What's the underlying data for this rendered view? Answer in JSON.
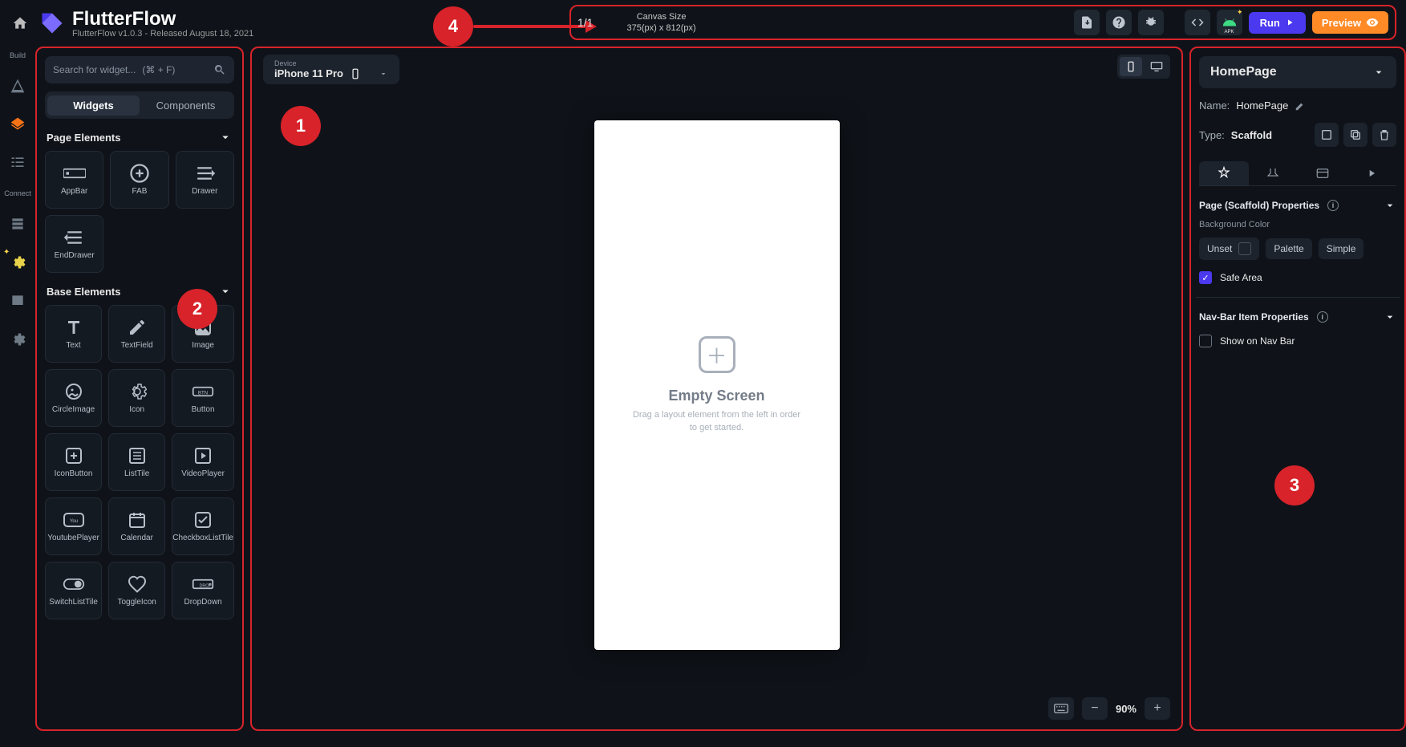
{
  "brand": {
    "title": "FlutterFlow",
    "subtitle": "FlutterFlow v1.0.3 - Released August 18, 2021"
  },
  "header": {
    "count": "1/1",
    "canvas_label": "Canvas Size",
    "canvas_value": "375(px) x 812(px)",
    "run": "Run",
    "preview": "Preview"
  },
  "activity": {
    "build": "Build",
    "connect": "Connect"
  },
  "left": {
    "search_placeholder": "Search for widget...",
    "search_hint": "(⌘ + F)",
    "tabs": {
      "widgets": "Widgets",
      "components": "Components"
    },
    "sections": {
      "page": "Page Elements",
      "base": "Base Elements"
    },
    "page_elements": [
      "AppBar",
      "FAB",
      "Drawer",
      "EndDrawer"
    ],
    "base_elements": [
      "Text",
      "TextField",
      "Image",
      "CircleImage",
      "Icon",
      "Button",
      "IconButton",
      "ListTile",
      "VideoPlayer",
      "YoutubePlayer",
      "Calendar",
      "CheckboxListTile",
      "SwitchListTile",
      "ToggleIcon",
      "DropDown"
    ]
  },
  "canvas": {
    "device_label": "Device",
    "device_value": "iPhone 11 Pro",
    "empty_title": "Empty Screen",
    "empty_sub": "Drag a layout element from the left in order to get started.",
    "zoom": "90%"
  },
  "right": {
    "page_name": "HomePage",
    "name_label": "Name:",
    "name_value": "HomePage",
    "type_label": "Type:",
    "type_value": "Scaffold",
    "scaffold_props": "Page (Scaffold) Properties",
    "bg_label": "Background Color",
    "unset": "Unset",
    "palette": "Palette",
    "simple": "Simple",
    "safe_area": "Safe Area",
    "nav_props": "Nav-Bar Item Properties",
    "show_nav": "Show on Nav Bar"
  },
  "annotations": {
    "a1": "1",
    "a2": "2",
    "a3": "3",
    "a4": "4"
  }
}
